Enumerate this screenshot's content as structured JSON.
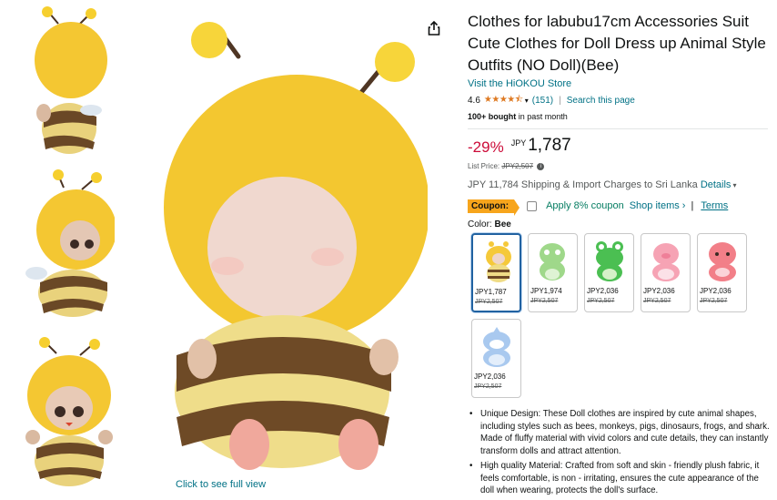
{
  "product": {
    "title": "Clothes for labubu17cm Accessories Suit Cute Clothes for Doll Dress up Animal Style Outfits (NO Doll)(Bee)",
    "store_link": "Visit the HiOKOU Store",
    "rating_value": "4.6",
    "rating_stars": "★★★★⯪",
    "rating_count": "(151)",
    "search_page": "Search this page",
    "bought_bold": "100+ bought",
    "bought_rest": " in past month"
  },
  "price": {
    "discount": "-29%",
    "currency": "JPY",
    "amount": "1,787",
    "list_label": "List Price:",
    "list_value": "JPY2,507"
  },
  "shipping": {
    "text": "JPY 11,784 Shipping & Import Charges to Sri Lanka",
    "details": "Details"
  },
  "coupon": {
    "badge": "Coupon:",
    "apply": "Apply 8% coupon",
    "shop_items": "Shop items ›",
    "sep": "|",
    "terms": "Terms"
  },
  "color": {
    "label": "Color:",
    "selected": "Bee"
  },
  "swatches": [
    {
      "name": "Bee",
      "price": "JPY1,787",
      "list": "JPY2,507",
      "color": "#f5c93a"
    },
    {
      "name": "Dinosaur",
      "price": "JPY1,974",
      "list": "JPY2,507",
      "color": "#9fd88a"
    },
    {
      "name": "Frog",
      "price": "JPY2,036",
      "list": "JPY2,507",
      "color": "#4bbf52"
    },
    {
      "name": "Pig",
      "price": "JPY2,036",
      "list": "JPY2,507",
      "color": "#f6a3b4"
    },
    {
      "name": "Octopus",
      "price": "JPY2,036",
      "list": "JPY2,507",
      "color": "#f27f88"
    },
    {
      "name": "Shark",
      "price": "JPY2,036",
      "list": "JPY2,507",
      "color": "#a9c9ef"
    }
  ],
  "full_view": "Click to see full view",
  "bullets": [
    "Unique Design: These Doll clothes are inspired by cute animal shapes, including styles such as bees, monkeys, pigs, dinosaurs, frogs, and shark. Made of fluffy material with vivid colors and cute details, they can instantly transform dolls and attract attention.",
    "High quality Material: Crafted from soft and skin - friendly plush fabric, it feels comfortable, is non - irritating, ensures the cute appearance of the doll when wearing, protects the doll's surface."
  ],
  "icons": {
    "share": "share-icon",
    "chevron": "chevron-down-icon",
    "info": "info-icon"
  }
}
